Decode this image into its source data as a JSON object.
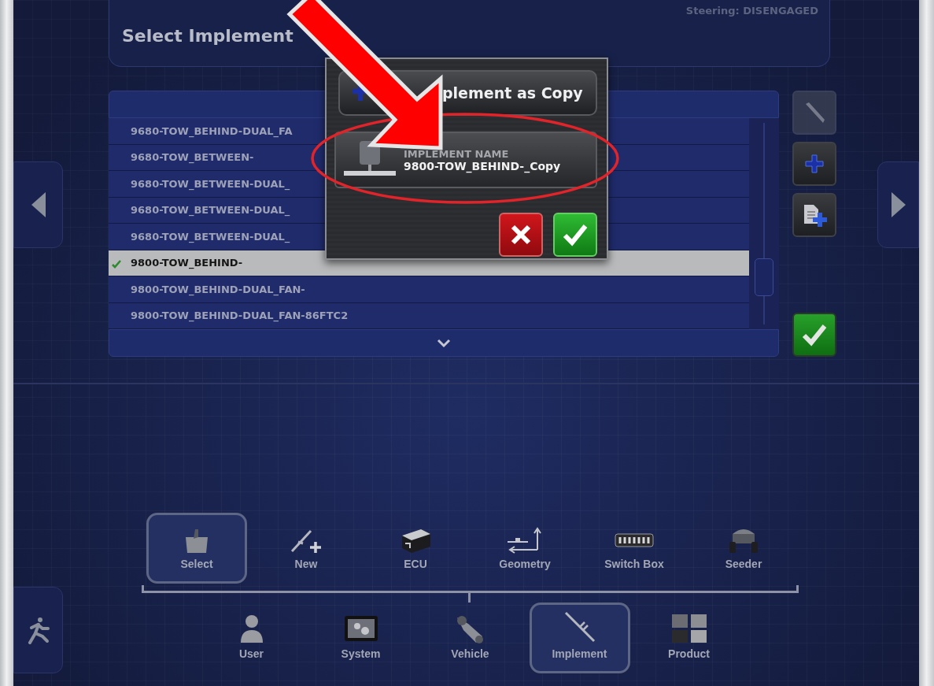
{
  "status": "Steering: DISENGAGED",
  "title": "Select Implement",
  "list": {
    "rows": [
      {
        "name": "9680-TOW_BEHIND-DUAL_FA",
        "selected": false
      },
      {
        "name": "9680-TOW_BETWEEN-",
        "selected": false
      },
      {
        "name": "9680-TOW_BETWEEN-DUAL_",
        "selected": false
      },
      {
        "name": "9680-TOW_BETWEEN-DUAL_",
        "selected": false
      },
      {
        "name": "9680-TOW_BETWEEN-DUAL_",
        "selected": false
      },
      {
        "name": "9800-TOW_BEHIND-",
        "selected": true
      },
      {
        "name": "9800-TOW_BEHIND-DUAL_FAN-",
        "selected": false
      },
      {
        "name": "9800-TOW_BEHIND-DUAL_FAN-86FTC2",
        "selected": false
      }
    ]
  },
  "side_buttons": [
    {
      "kind": "edit",
      "disabled": true
    },
    {
      "kind": "add",
      "disabled": false
    },
    {
      "kind": "copy",
      "disabled": false
    }
  ],
  "dialog": {
    "title": "plement as Copy",
    "field_label": "IMPLEMENT NAME",
    "field_value": "9800-TOW_BEHIND-_Copy"
  },
  "sub_menu": [
    {
      "kind": "select",
      "label": "Select",
      "selected": true
    },
    {
      "kind": "new",
      "label": "New",
      "selected": false
    },
    {
      "kind": "ecu",
      "label": "ECU",
      "selected": false
    },
    {
      "kind": "geometry",
      "label": "Geometry",
      "selected": false
    },
    {
      "kind": "switchbox",
      "label": "Switch Box",
      "selected": false
    },
    {
      "kind": "seeder",
      "label": "Seeder",
      "selected": false
    }
  ],
  "main_menu": [
    {
      "kind": "user",
      "label": "User",
      "selected": false
    },
    {
      "kind": "system",
      "label": "System",
      "selected": false
    },
    {
      "kind": "vehicle",
      "label": "Vehicle",
      "selected": false
    },
    {
      "kind": "implement",
      "label": "Implement",
      "selected": true
    },
    {
      "kind": "product",
      "label": "Product",
      "selected": false
    }
  ]
}
